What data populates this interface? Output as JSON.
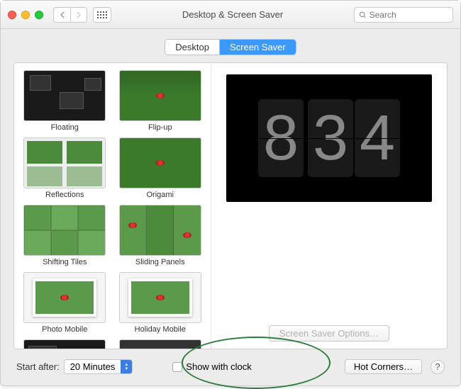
{
  "window": {
    "title": "Desktop & Screen Saver",
    "search_placeholder": "Search"
  },
  "tabs": {
    "desktop": "Desktop",
    "screensaver": "Screen Saver"
  },
  "savers": [
    {
      "name": "Floating"
    },
    {
      "name": "Flip-up"
    },
    {
      "name": "Reflections"
    },
    {
      "name": "Origami"
    },
    {
      "name": "Shifting Tiles"
    },
    {
      "name": "Sliding Panels"
    },
    {
      "name": "Photo Mobile"
    },
    {
      "name": "Holiday Mobile"
    }
  ],
  "preview": {
    "hour": "8",
    "minute_tens": "3",
    "minute_ones": "4"
  },
  "options_button": "Screen Saver Options…",
  "bottom": {
    "start_after_label": "Start after:",
    "start_after_value": "20 Minutes",
    "show_with_clock": "Show with clock",
    "hot_corners": "Hot Corners…",
    "help": "?"
  }
}
